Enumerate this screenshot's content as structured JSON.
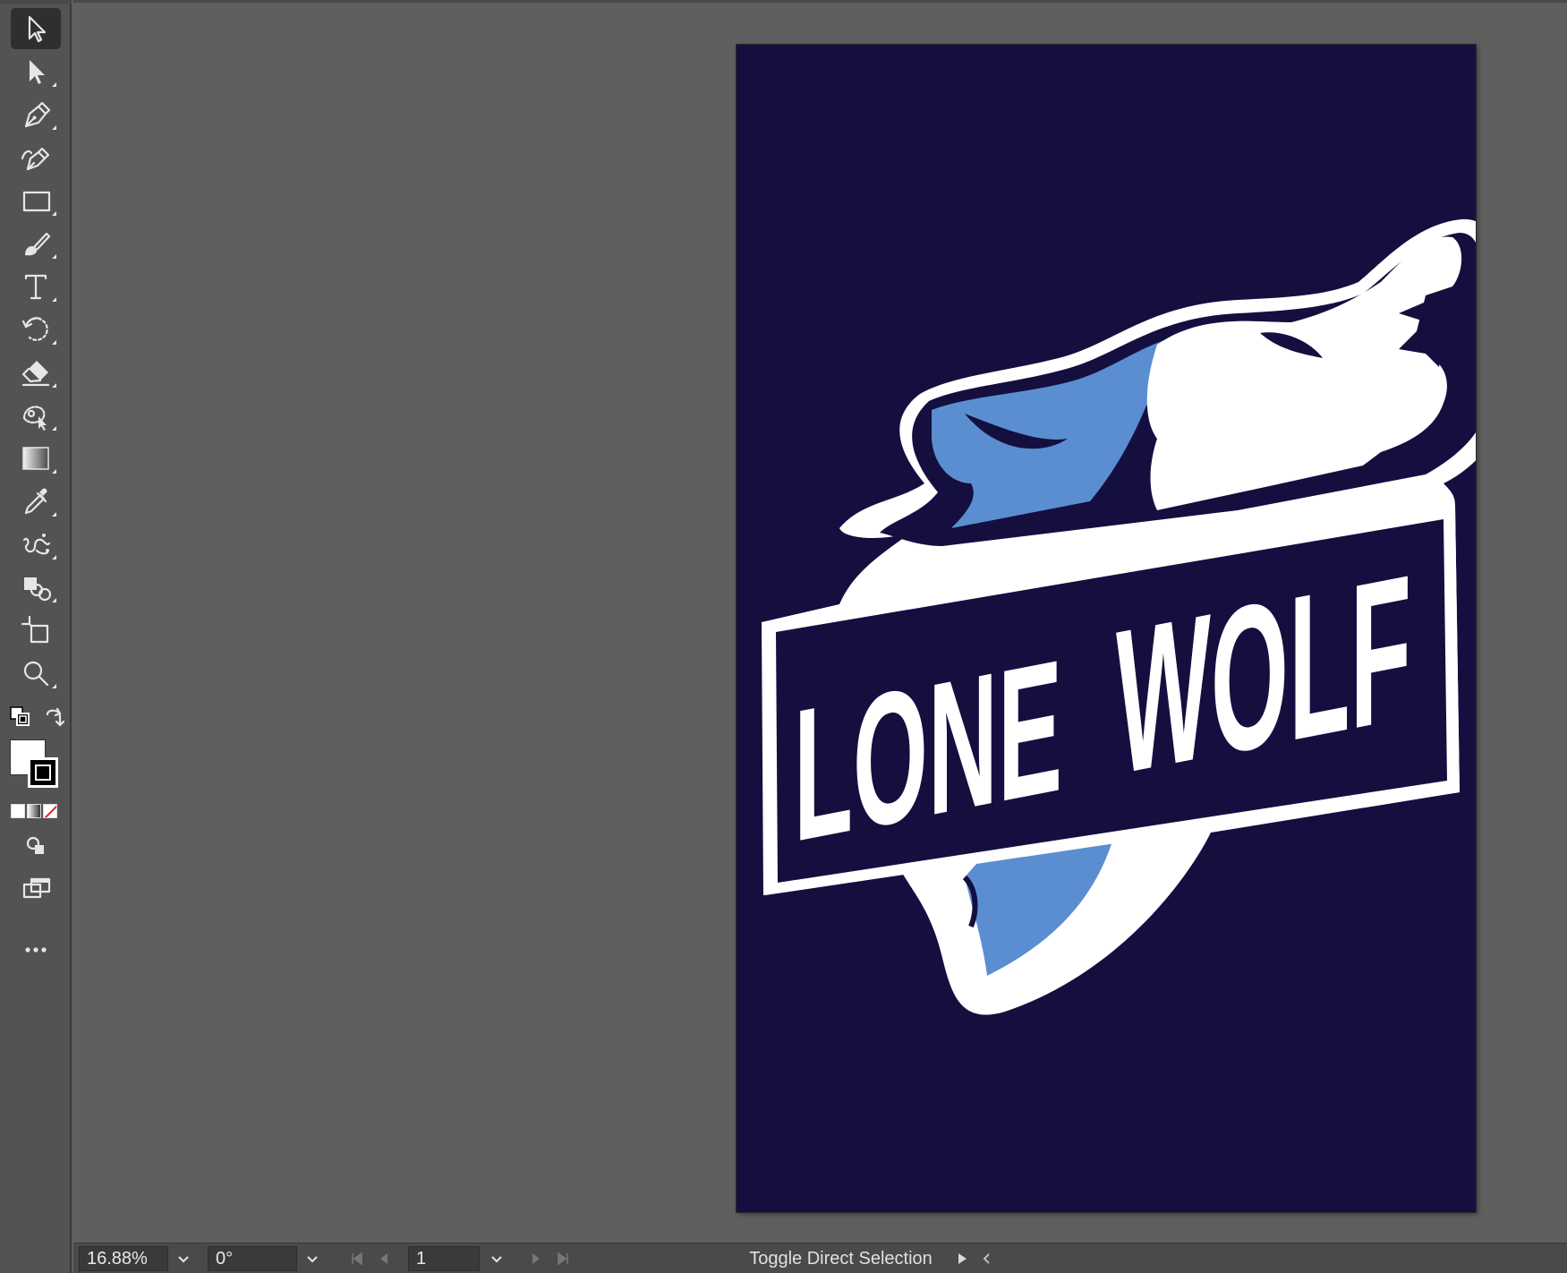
{
  "toolbar": {
    "tools": [
      {
        "name": "selection-tool",
        "icon": "selection-arrow-icon",
        "active": true
      },
      {
        "name": "direct-selection-tool",
        "icon": "direct-selection-arrow-icon"
      },
      {
        "name": "pen-tool",
        "icon": "pen-icon"
      },
      {
        "name": "curvature-tool",
        "icon": "curvature-pen-icon"
      },
      {
        "name": "rectangle-tool",
        "icon": "rectangle-icon"
      },
      {
        "name": "paintbrush-tool",
        "icon": "paintbrush-icon"
      },
      {
        "name": "type-tool",
        "icon": "type-icon"
      },
      {
        "name": "rotate-tool",
        "icon": "rotate-icon"
      },
      {
        "name": "eraser-tool",
        "icon": "eraser-icon"
      },
      {
        "name": "puppet-warp-tool",
        "icon": "puppet-warp-icon"
      },
      {
        "name": "gradient-tool",
        "icon": "gradient-icon"
      },
      {
        "name": "eyedropper-tool",
        "icon": "eyedropper-icon"
      },
      {
        "name": "symbol-sprayer-tool",
        "icon": "symbol-sprayer-icon"
      },
      {
        "name": "shape-builder-tool",
        "icon": "shape-builder-icon"
      },
      {
        "name": "artboard-tool",
        "icon": "artboard-icon"
      },
      {
        "name": "zoom-tool",
        "icon": "zoom-icon"
      }
    ],
    "fill_color": "#ffffff",
    "stroke_color": "#000000"
  },
  "artboard": {
    "background_color": "#150f40",
    "logo_text_line1": "LONE",
    "logo_text_line2": "WOLF",
    "wolf_blue": "#5a8ed0",
    "wolf_white": "#ffffff"
  },
  "statusbar": {
    "zoom": "16.88%",
    "rotation": "0°",
    "artboard_number": "1",
    "status_text": "Toggle Direct Selection"
  }
}
